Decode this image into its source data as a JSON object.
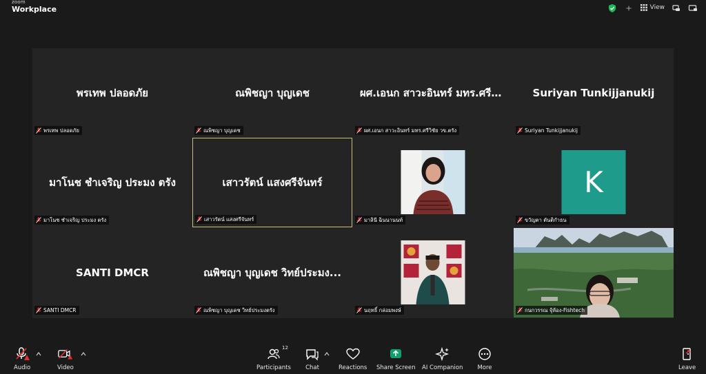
{
  "app": {
    "brand_small": "zoom",
    "brand_big": "Workplace"
  },
  "topbar": {
    "view_label": "View"
  },
  "tiles": [
    {
      "name": "พรเทพ ปลอดภัย",
      "label": "พรเทพ ปลอดภัย"
    },
    {
      "name": "ณพิชญา บุญเดช",
      "label": "ณพิชญา บุญเดช"
    },
    {
      "name": "ผศ.เอนก สาวะอินทร์ มทร.ศรีวิ...",
      "label": "ผศ.เอนก สาวะอินทร์ มทร.ศรีวิชัย วข.ตรัง"
    },
    {
      "name": "Suriyan Tunkijjanukij",
      "label": "Suriyan Tunkijjanukij"
    },
    {
      "name": "มาโนช ชำเจริญ ประมง ตรัง",
      "label": "มาโนช ชำเจริญ ประมง ตรัง"
    },
    {
      "name": "เสาวรัตน์ แสงศรีจันทร์",
      "label": "เสาวรัตน์ แสงศรีจันทร์"
    },
    {
      "label": "มาลินี ฉินนานนท์"
    },
    {
      "avatar_letter": "K",
      "label": "ขวัญตา ตันติกำธน"
    },
    {
      "name": "SANTI DMCR",
      "label": "SANTI DMCR"
    },
    {
      "name": "ณพิชญา บุญเดช วิทย์ประมง...",
      "label": "ณพิชญา บุญเดช วิทย์ประมงตรัง"
    },
    {
      "label": "นฤทธิ์ กล่อมพงษ์"
    },
    {
      "label": "กนกวรรณ จุ้ห้อง-Fishtech"
    }
  ],
  "toolbar": {
    "audio": "Audio",
    "video": "Video",
    "participants": "Participants",
    "participants_count": "12",
    "chat": "Chat",
    "reactions": "Reactions",
    "share_screen": "Share Screen",
    "ai_companion": "AI Companion",
    "more": "More",
    "leave": "Leave"
  },
  "colors": {
    "background": "#1a1a1a",
    "tile_bg": "#242424",
    "active_border": "#c9c17a",
    "mute_red": "#e02f2f",
    "share_green": "#0e9f6e",
    "avatar_teal": "#1f9b8c"
  }
}
